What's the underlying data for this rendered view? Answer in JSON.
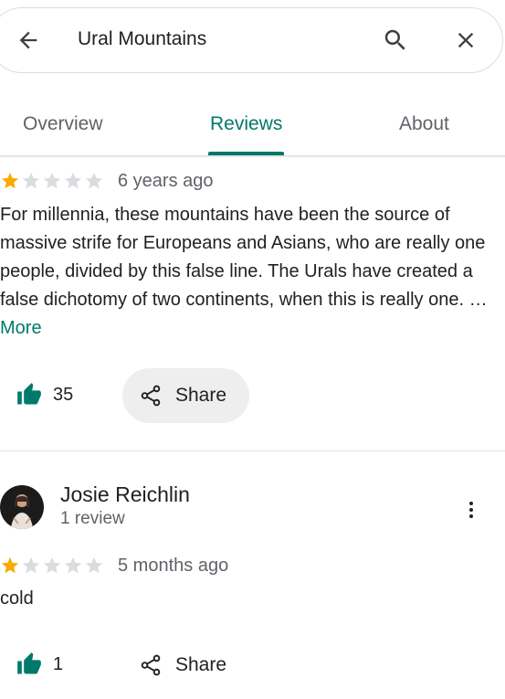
{
  "search": {
    "query": "Ural Mountains"
  },
  "tabs": [
    {
      "label": "Overview"
    },
    {
      "label": "Reviews",
      "active": true
    },
    {
      "label": "About"
    }
  ],
  "colors": {
    "accent": "#00796b",
    "star_filled": "#f9ab00",
    "star_empty": "#dadce0"
  },
  "reviews": [
    {
      "rating": 1,
      "time": "6 years ago",
      "text": "For millennia, these mountains have been the source of massive strife for Europeans and Asians, who are really one people, divided by this false line. The Urals have created a false dichotomy of two continents, when this is really one. …",
      "more_label": "More",
      "likes": "35",
      "share_label": "Share"
    },
    {
      "reviewer_name": "Josie Reichlin",
      "reviewer_meta": "1 review",
      "rating": 1,
      "time": "5 months ago",
      "text": "cold",
      "likes": "1",
      "share_label": "Share"
    }
  ]
}
